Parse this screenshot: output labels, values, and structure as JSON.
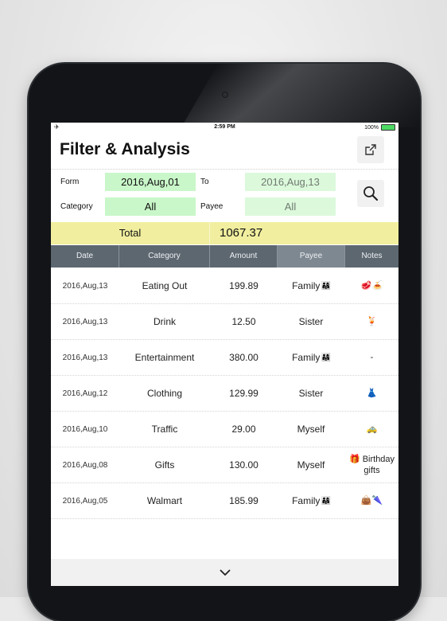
{
  "status_bar": {
    "time": "2:59 PM",
    "battery": "100%",
    "battery_level": 1.0
  },
  "header": {
    "title": "Filter & Analysis"
  },
  "filter": {
    "from_label": "Form",
    "from_value": "2016,Aug,01",
    "to_label": "To",
    "to_value": "2016,Aug,13",
    "category_label": "Category",
    "category_value": "All",
    "payee_label": "Payee",
    "payee_value": "All"
  },
  "total": {
    "label": "Total",
    "value": "1067.37"
  },
  "table": {
    "columns": [
      "Date",
      "Category",
      "Amount",
      "Payee",
      "Notes"
    ],
    "rows": [
      {
        "date": "2016,Aug,13",
        "category": "Eating Out",
        "amount": "199.89",
        "payee": "Family",
        "payee_emoji": "👨‍👩‍👧",
        "notes": "🥩🍝"
      },
      {
        "date": "2016,Aug,13",
        "category": "Drink",
        "amount": "12.50",
        "payee": "Sister",
        "payee_emoji": "",
        "notes": "🍹"
      },
      {
        "date": "2016,Aug,13",
        "category": "Entertainment",
        "amount": "380.00",
        "payee": "Family",
        "payee_emoji": "👨‍👩‍👧",
        "notes": "-"
      },
      {
        "date": "2016,Aug,12",
        "category": "Clothing",
        "amount": "129.99",
        "payee": "Sister",
        "payee_emoji": "",
        "notes": "👗"
      },
      {
        "date": "2016,Aug,10",
        "category": "Traffic",
        "amount": "29.00",
        "payee": "Myself",
        "payee_emoji": "",
        "notes": "🚕"
      },
      {
        "date": "2016,Aug,08",
        "category": "Gifts",
        "amount": "130.00",
        "payee": "Myself",
        "payee_emoji": "",
        "notes": "🎁 Birthday gifts"
      },
      {
        "date": "2016,Aug,05",
        "category": "Walmart",
        "amount": "185.99",
        "payee": "Family",
        "payee_emoji": "👨‍👩‍👧",
        "notes": "👜🌂"
      }
    ]
  },
  "icons": {
    "share": "share-icon",
    "search": "search-icon",
    "collapse": "chevron-down-icon"
  },
  "colors": {
    "filter_field": "#c9f7c9",
    "total_row": "#f1ef9f",
    "table_header": "#5d6770"
  }
}
